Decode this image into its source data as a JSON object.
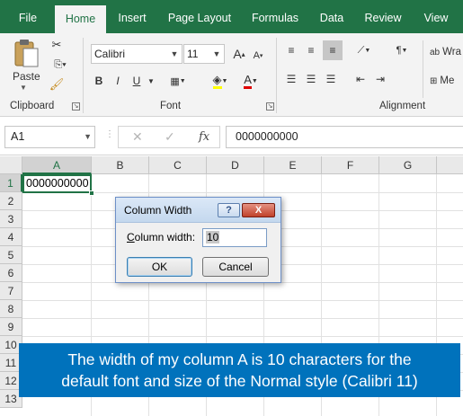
{
  "ribbon_tabs": [
    {
      "label": "File"
    },
    {
      "label": "Home"
    },
    {
      "label": "Insert"
    },
    {
      "label": "Page Layout"
    },
    {
      "label": "Formulas"
    },
    {
      "label": "Data"
    },
    {
      "label": "Review"
    },
    {
      "label": "View"
    }
  ],
  "active_tab": "Home",
  "ribbon": {
    "clipboard": {
      "paste_label": "Paste",
      "group_label": "Clipboard"
    },
    "font": {
      "font_name": "Calibri",
      "font_size": "11",
      "group_label": "Font",
      "bold": "B",
      "italic": "I",
      "underline": "U",
      "grow": "A",
      "shrink": "A",
      "font_color_letter": "A"
    },
    "alignment": {
      "group_label": "Alignment",
      "wrap_text_partial": "Wra",
      "merge_partial": "Me"
    }
  },
  "formula_bar": {
    "name_box": "A1",
    "fx": "fx",
    "formula": "0000000000"
  },
  "grid": {
    "columns": [
      "A",
      "B",
      "C",
      "D",
      "E",
      "F",
      "G"
    ],
    "rows": [
      "1",
      "2",
      "3",
      "4",
      "5",
      "6",
      "7",
      "8",
      "9",
      "10",
      "11",
      "12",
      "13"
    ],
    "selected_cell": "A1",
    "a1_value": "0000000000"
  },
  "dialog": {
    "title": "Column Width",
    "help": "?",
    "close": "X",
    "label": "olumn width:",
    "label_mnemonic": "C",
    "value": "10",
    "ok": "OK",
    "cancel": "Cancel"
  },
  "banner": {
    "line1": "The width of my column A is 10 characters for the",
    "line2": "default font and size of the Normal style (Calibri 11)"
  },
  "colors": {
    "excel_green": "#217346",
    "banner_blue": "#0072bc"
  }
}
